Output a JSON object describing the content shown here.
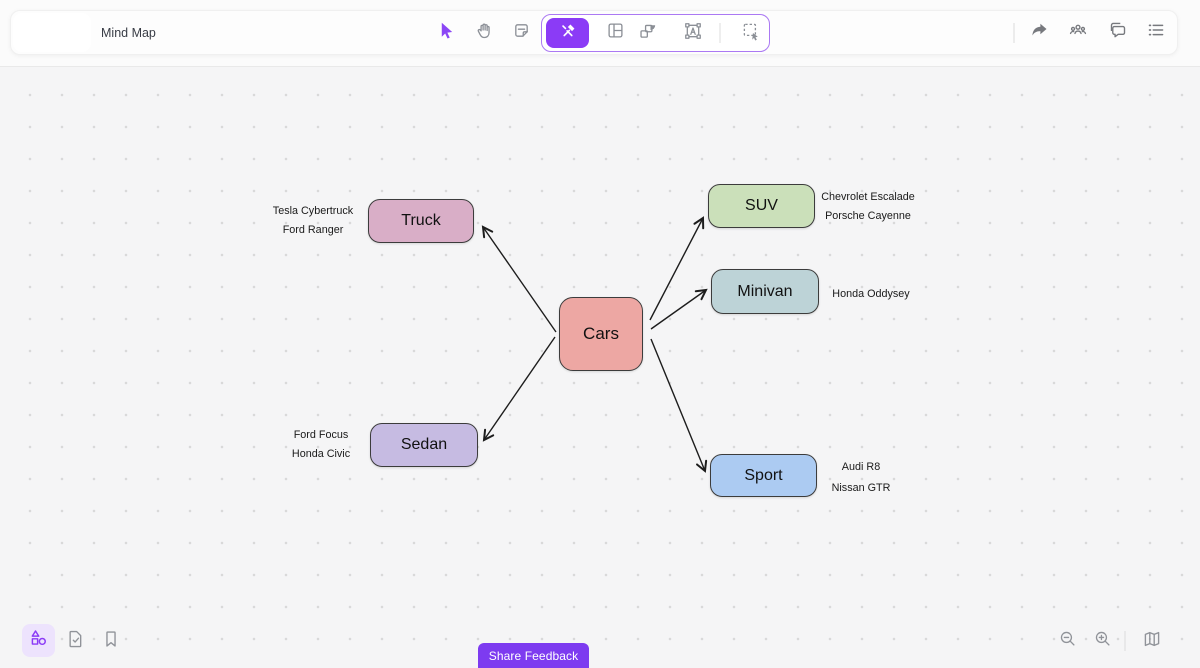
{
  "toolbar": {
    "title": "Mind Map",
    "center_icons": [
      "cursor-icon",
      "hand-icon",
      "note-icon",
      "tools-icon",
      "layout-icon",
      "shapes-icon",
      "text-frame-icon",
      "marquee-icon"
    ],
    "right_icons": [
      "share-icon",
      "people-icon",
      "comments-icon",
      "list-icon"
    ],
    "active_tool": "tools"
  },
  "colors": {
    "accent": "#8b3bf6",
    "tool_group_border": "#ab79f3",
    "feedback_button": "#7d3bf0",
    "node_border": "#3c3c3c",
    "arrow": "#1d1d1d",
    "canvas_bg": "#f5f5f6"
  },
  "mindmap": {
    "nodes": [
      {
        "id": "cars",
        "label": "Cars",
        "fill": "#eda7a3",
        "notes": []
      },
      {
        "id": "truck",
        "label": "Truck",
        "fill": "#d9aec7",
        "notes": [
          "Tesla Cybertruck",
          "Ford Ranger"
        ]
      },
      {
        "id": "suv",
        "label": "SUV",
        "fill": "#cbe0ba",
        "notes": [
          "Chevrolet Escalade",
          "Porsche Cayenne"
        ]
      },
      {
        "id": "minivan",
        "label": "Minivan",
        "fill": "#bdd3d7",
        "notes": [
          "Honda Oddysey"
        ]
      },
      {
        "id": "sedan",
        "label": "Sedan",
        "fill": "#c6bbe2",
        "notes": [
          "Ford Focus",
          "Honda Civic"
        ]
      },
      {
        "id": "sport",
        "label": "Sport",
        "fill": "#accbf2",
        "notes": [
          "Audi R8",
          "Nissan GTR"
        ]
      }
    ],
    "edges": [
      {
        "from": "cars",
        "to": "truck"
      },
      {
        "from": "cars",
        "to": "sedan"
      },
      {
        "from": "cars",
        "to": "suv"
      },
      {
        "from": "cars",
        "to": "minivan"
      },
      {
        "from": "cars",
        "to": "sport"
      }
    ]
  },
  "footer": {
    "left_icons": [
      "shapes-panel-icon",
      "checklist-icon",
      "bookmark-icon"
    ],
    "share_feedback_label": "Share Feedback",
    "right_icons": [
      "zoom-out-icon",
      "zoom-in-icon",
      "map-icon"
    ]
  }
}
